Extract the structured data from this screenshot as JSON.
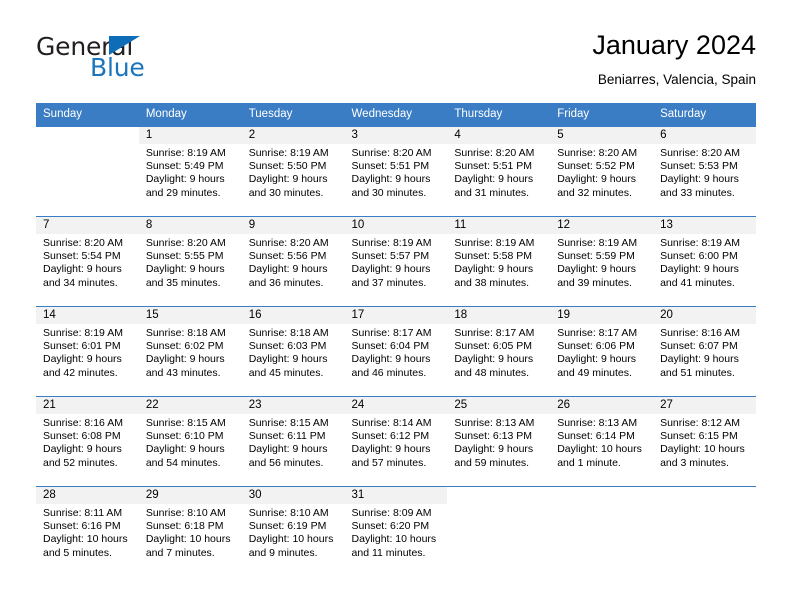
{
  "brand": {
    "name_part1": "General",
    "name_part2": "Blue",
    "triangle_color": "#0f6cb6",
    "blue_text_color": "#1b75bc"
  },
  "header": {
    "title": "January 2024",
    "subtitle": "Beniarres, Valencia, Spain"
  },
  "theme": {
    "header_blue": "#3b7dc4",
    "daynum_bg": "#f2f2f2"
  },
  "weekdays": [
    "Sunday",
    "Monday",
    "Tuesday",
    "Wednesday",
    "Thursday",
    "Friday",
    "Saturday"
  ],
  "labels": {
    "sunrise": "Sunrise:",
    "sunset": "Sunset:",
    "daylight": "Daylight:"
  },
  "weeks": [
    [
      {
        "day": "",
        "blank": true
      },
      {
        "day": "1",
        "sunrise": "Sunrise: 8:19 AM",
        "sunset": "Sunset: 5:49 PM",
        "daylight1": "Daylight: 9 hours",
        "daylight2": "and 29 minutes."
      },
      {
        "day": "2",
        "sunrise": "Sunrise: 8:19 AM",
        "sunset": "Sunset: 5:50 PM",
        "daylight1": "Daylight: 9 hours",
        "daylight2": "and 30 minutes."
      },
      {
        "day": "3",
        "sunrise": "Sunrise: 8:20 AM",
        "sunset": "Sunset: 5:51 PM",
        "daylight1": "Daylight: 9 hours",
        "daylight2": "and 30 minutes."
      },
      {
        "day": "4",
        "sunrise": "Sunrise: 8:20 AM",
        "sunset": "Sunset: 5:51 PM",
        "daylight1": "Daylight: 9 hours",
        "daylight2": "and 31 minutes."
      },
      {
        "day": "5",
        "sunrise": "Sunrise: 8:20 AM",
        "sunset": "Sunset: 5:52 PM",
        "daylight1": "Daylight: 9 hours",
        "daylight2": "and 32 minutes."
      },
      {
        "day": "6",
        "sunrise": "Sunrise: 8:20 AM",
        "sunset": "Sunset: 5:53 PM",
        "daylight1": "Daylight: 9 hours",
        "daylight2": "and 33 minutes."
      }
    ],
    [
      {
        "day": "7",
        "sunrise": "Sunrise: 8:20 AM",
        "sunset": "Sunset: 5:54 PM",
        "daylight1": "Daylight: 9 hours",
        "daylight2": "and 34 minutes."
      },
      {
        "day": "8",
        "sunrise": "Sunrise: 8:20 AM",
        "sunset": "Sunset: 5:55 PM",
        "daylight1": "Daylight: 9 hours",
        "daylight2": "and 35 minutes."
      },
      {
        "day": "9",
        "sunrise": "Sunrise: 8:20 AM",
        "sunset": "Sunset: 5:56 PM",
        "daylight1": "Daylight: 9 hours",
        "daylight2": "and 36 minutes."
      },
      {
        "day": "10",
        "sunrise": "Sunrise: 8:19 AM",
        "sunset": "Sunset: 5:57 PM",
        "daylight1": "Daylight: 9 hours",
        "daylight2": "and 37 minutes."
      },
      {
        "day": "11",
        "sunrise": "Sunrise: 8:19 AM",
        "sunset": "Sunset: 5:58 PM",
        "daylight1": "Daylight: 9 hours",
        "daylight2": "and 38 minutes."
      },
      {
        "day": "12",
        "sunrise": "Sunrise: 8:19 AM",
        "sunset": "Sunset: 5:59 PM",
        "daylight1": "Daylight: 9 hours",
        "daylight2": "and 39 minutes."
      },
      {
        "day": "13",
        "sunrise": "Sunrise: 8:19 AM",
        "sunset": "Sunset: 6:00 PM",
        "daylight1": "Daylight: 9 hours",
        "daylight2": "and 41 minutes."
      }
    ],
    [
      {
        "day": "14",
        "sunrise": "Sunrise: 8:19 AM",
        "sunset": "Sunset: 6:01 PM",
        "daylight1": "Daylight: 9 hours",
        "daylight2": "and 42 minutes."
      },
      {
        "day": "15",
        "sunrise": "Sunrise: 8:18 AM",
        "sunset": "Sunset: 6:02 PM",
        "daylight1": "Daylight: 9 hours",
        "daylight2": "and 43 minutes."
      },
      {
        "day": "16",
        "sunrise": "Sunrise: 8:18 AM",
        "sunset": "Sunset: 6:03 PM",
        "daylight1": "Daylight: 9 hours",
        "daylight2": "and 45 minutes."
      },
      {
        "day": "17",
        "sunrise": "Sunrise: 8:17 AM",
        "sunset": "Sunset: 6:04 PM",
        "daylight1": "Daylight: 9 hours",
        "daylight2": "and 46 minutes."
      },
      {
        "day": "18",
        "sunrise": "Sunrise: 8:17 AM",
        "sunset": "Sunset: 6:05 PM",
        "daylight1": "Daylight: 9 hours",
        "daylight2": "and 48 minutes."
      },
      {
        "day": "19",
        "sunrise": "Sunrise: 8:17 AM",
        "sunset": "Sunset: 6:06 PM",
        "daylight1": "Daylight: 9 hours",
        "daylight2": "and 49 minutes."
      },
      {
        "day": "20",
        "sunrise": "Sunrise: 8:16 AM",
        "sunset": "Sunset: 6:07 PM",
        "daylight1": "Daylight: 9 hours",
        "daylight2": "and 51 minutes."
      }
    ],
    [
      {
        "day": "21",
        "sunrise": "Sunrise: 8:16 AM",
        "sunset": "Sunset: 6:08 PM",
        "daylight1": "Daylight: 9 hours",
        "daylight2": "and 52 minutes."
      },
      {
        "day": "22",
        "sunrise": "Sunrise: 8:15 AM",
        "sunset": "Sunset: 6:10 PM",
        "daylight1": "Daylight: 9 hours",
        "daylight2": "and 54 minutes."
      },
      {
        "day": "23",
        "sunrise": "Sunrise: 8:15 AM",
        "sunset": "Sunset: 6:11 PM",
        "daylight1": "Daylight: 9 hours",
        "daylight2": "and 56 minutes."
      },
      {
        "day": "24",
        "sunrise": "Sunrise: 8:14 AM",
        "sunset": "Sunset: 6:12 PM",
        "daylight1": "Daylight: 9 hours",
        "daylight2": "and 57 minutes."
      },
      {
        "day": "25",
        "sunrise": "Sunrise: 8:13 AM",
        "sunset": "Sunset: 6:13 PM",
        "daylight1": "Daylight: 9 hours",
        "daylight2": "and 59 minutes."
      },
      {
        "day": "26",
        "sunrise": "Sunrise: 8:13 AM",
        "sunset": "Sunset: 6:14 PM",
        "daylight1": "Daylight: 10 hours",
        "daylight2": "and 1 minute."
      },
      {
        "day": "27",
        "sunrise": "Sunrise: 8:12 AM",
        "sunset": "Sunset: 6:15 PM",
        "daylight1": "Daylight: 10 hours",
        "daylight2": "and 3 minutes."
      }
    ],
    [
      {
        "day": "28",
        "sunrise": "Sunrise: 8:11 AM",
        "sunset": "Sunset: 6:16 PM",
        "daylight1": "Daylight: 10 hours",
        "daylight2": "and 5 minutes."
      },
      {
        "day": "29",
        "sunrise": "Sunrise: 8:10 AM",
        "sunset": "Sunset: 6:18 PM",
        "daylight1": "Daylight: 10 hours",
        "daylight2": "and 7 minutes."
      },
      {
        "day": "30",
        "sunrise": "Sunrise: 8:10 AM",
        "sunset": "Sunset: 6:19 PM",
        "daylight1": "Daylight: 10 hours",
        "daylight2": "and 9 minutes."
      },
      {
        "day": "31",
        "sunrise": "Sunrise: 8:09 AM",
        "sunset": "Sunset: 6:20 PM",
        "daylight1": "Daylight: 10 hours",
        "daylight2": "and 11 minutes."
      },
      {
        "day": "",
        "blank": true
      },
      {
        "day": "",
        "blank": true
      },
      {
        "day": "",
        "blank": true
      }
    ]
  ]
}
